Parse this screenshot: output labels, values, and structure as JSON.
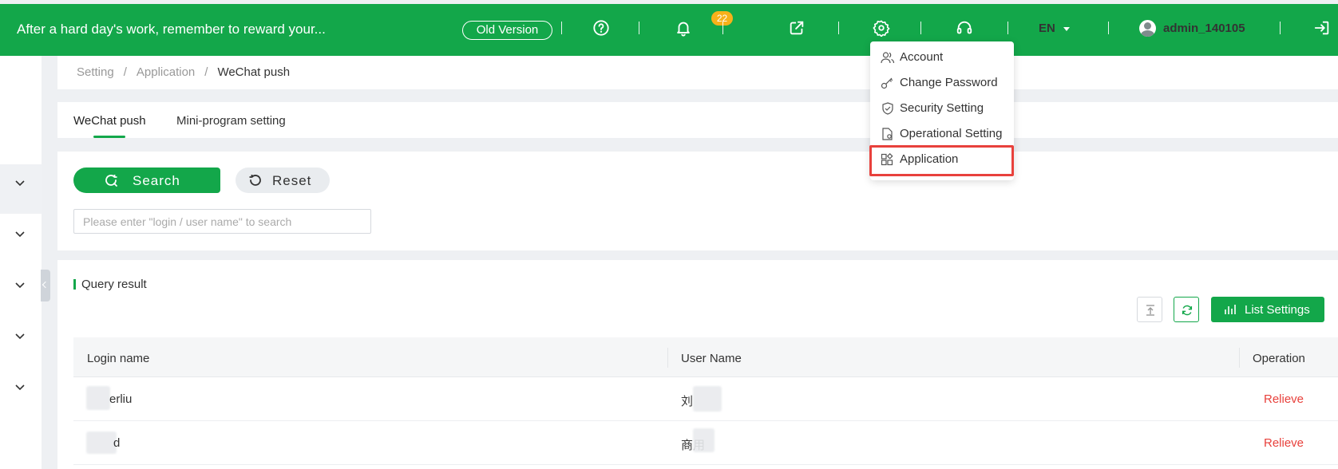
{
  "header": {
    "slogan": "After a hard day's work, remember to reward your...",
    "old_version": "Old Version",
    "notification_count": "22",
    "language": "EN",
    "username": "admin_140105"
  },
  "user_menu": {
    "items": [
      {
        "label": "Account",
        "icon": "user-group-icon"
      },
      {
        "label": "Change Password",
        "icon": "key-icon"
      },
      {
        "label": "Security Setting",
        "icon": "shield-icon"
      },
      {
        "label": "Operational Setting",
        "icon": "document-settings-icon"
      },
      {
        "label": "Application",
        "icon": "apps-icon",
        "highlighted": true
      }
    ]
  },
  "breadcrumb": {
    "items": [
      "Setting",
      "Application",
      "WeChat push"
    ],
    "separator": "/"
  },
  "tabs": [
    {
      "label": "WeChat push",
      "active": true
    },
    {
      "label": "Mini-program setting",
      "active": false
    }
  ],
  "filters": {
    "search_label": "Search",
    "reset_label": "Reset",
    "search_placeholder": "Please enter \"login / user name\" to search"
  },
  "results": {
    "title": "Query result",
    "list_settings_label": "List Settings",
    "columns": [
      "Login name",
      "User Name",
      "Operation"
    ],
    "rows": [
      {
        "login": "erliu",
        "user": "刘",
        "op": "Relieve"
      },
      {
        "login": "d",
        "user": "商用",
        "op": "Relieve"
      }
    ]
  },
  "colors": {
    "brand": "#13a74a",
    "danger": "#e8413c",
    "badge": "#f7b11a"
  }
}
